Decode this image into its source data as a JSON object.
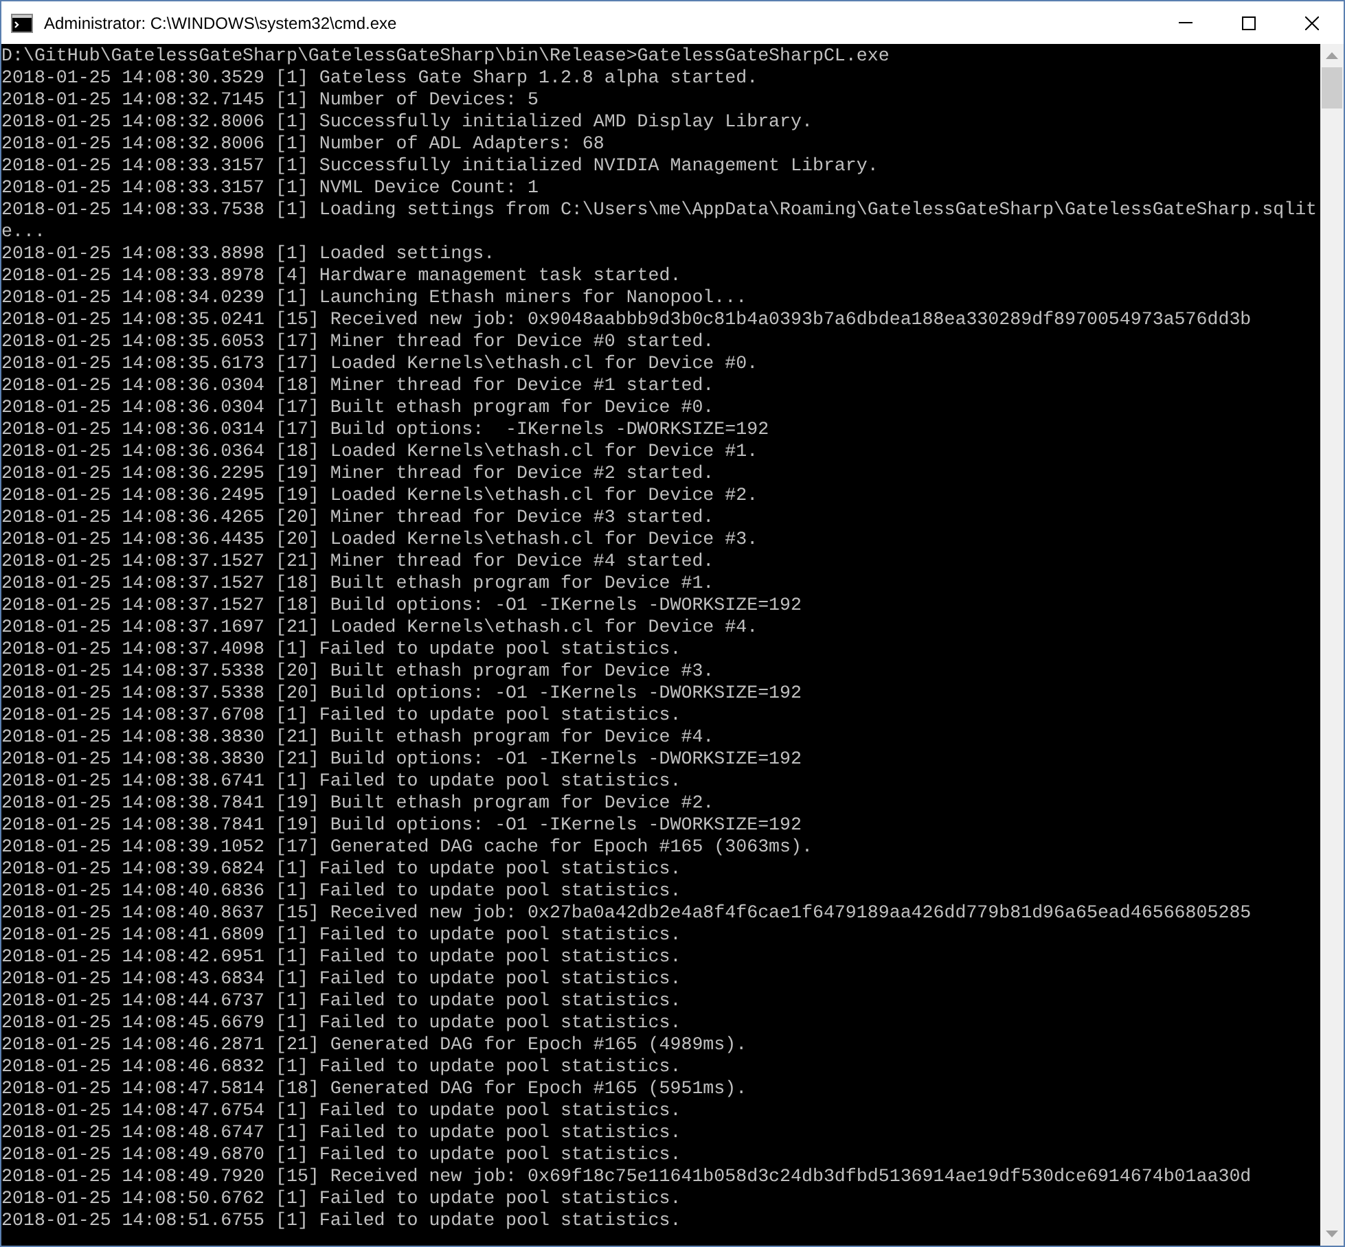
{
  "window": {
    "title": "Administrator: C:\\WINDOWS\\system32\\cmd.exe"
  },
  "console": {
    "lines": [
      "D:\\GitHub\\GatelessGateSharp\\GatelessGateSharp\\bin\\Release>GatelessGateSharpCL.exe",
      "2018-01-25 14:08:30.3529 [1] Gateless Gate Sharp 1.2.8 alpha started.",
      "2018-01-25 14:08:32.7145 [1] Number of Devices: 5",
      "2018-01-25 14:08:32.8006 [1] Successfully initialized AMD Display Library.",
      "2018-01-25 14:08:32.8006 [1] Number of ADL Adapters: 68",
      "2018-01-25 14:08:33.3157 [1] Successfully initialized NVIDIA Management Library.",
      "2018-01-25 14:08:33.3157 [1] NVML Device Count: 1",
      "2018-01-25 14:08:33.7538 [1] Loading settings from C:\\Users\\me\\AppData\\Roaming\\GatelessGateSharp\\GatelessGateSharp.sqlit",
      "e...",
      "2018-01-25 14:08:33.8898 [1] Loaded settings.",
      "2018-01-25 14:08:33.8978 [4] Hardware management task started.",
      "2018-01-25 14:08:34.0239 [1] Launching Ethash miners for Nanopool...",
      "2018-01-25 14:08:35.0241 [15] Received new job: 0x9048aabbb9d3b0c81b4a0393b7a6dbdea188ea330289df8970054973a576dd3b",
      "2018-01-25 14:08:35.6053 [17] Miner thread for Device #0 started.",
      "2018-01-25 14:08:35.6173 [17] Loaded Kernels\\ethash.cl for Device #0.",
      "2018-01-25 14:08:36.0304 [18] Miner thread for Device #1 started.",
      "2018-01-25 14:08:36.0304 [17] Built ethash program for Device #0.",
      "2018-01-25 14:08:36.0314 [17] Build options:  -IKernels -DWORKSIZE=192",
      "2018-01-25 14:08:36.0364 [18] Loaded Kernels\\ethash.cl for Device #1.",
      "2018-01-25 14:08:36.2295 [19] Miner thread for Device #2 started.",
      "2018-01-25 14:08:36.2495 [19] Loaded Kernels\\ethash.cl for Device #2.",
      "2018-01-25 14:08:36.4265 [20] Miner thread for Device #3 started.",
      "2018-01-25 14:08:36.4435 [20] Loaded Kernels\\ethash.cl for Device #3.",
      "2018-01-25 14:08:37.1527 [21] Miner thread for Device #4 started.",
      "2018-01-25 14:08:37.1527 [18] Built ethash program for Device #1.",
      "2018-01-25 14:08:37.1527 [18] Build options: -O1 -IKernels -DWORKSIZE=192",
      "2018-01-25 14:08:37.1697 [21] Loaded Kernels\\ethash.cl for Device #4.",
      "2018-01-25 14:08:37.4098 [1] Failed to update pool statistics.",
      "2018-01-25 14:08:37.5338 [20] Built ethash program for Device #3.",
      "2018-01-25 14:08:37.5338 [20] Build options: -O1 -IKernels -DWORKSIZE=192",
      "2018-01-25 14:08:37.6708 [1] Failed to update pool statistics.",
      "2018-01-25 14:08:38.3830 [21] Built ethash program for Device #4.",
      "2018-01-25 14:08:38.3830 [21] Build options: -O1 -IKernels -DWORKSIZE=192",
      "2018-01-25 14:08:38.6741 [1] Failed to update pool statistics.",
      "2018-01-25 14:08:38.7841 [19] Built ethash program for Device #2.",
      "2018-01-25 14:08:38.7841 [19] Build options: -O1 -IKernels -DWORKSIZE=192",
      "2018-01-25 14:08:39.1052 [17] Generated DAG cache for Epoch #165 (3063ms).",
      "2018-01-25 14:08:39.6824 [1] Failed to update pool statistics.",
      "2018-01-25 14:08:40.6836 [1] Failed to update pool statistics.",
      "2018-01-25 14:08:40.8637 [15] Received new job: 0x27ba0a42db2e4a8f4f6cae1f6479189aa426dd779b81d96a65ead46566805285",
      "2018-01-25 14:08:41.6809 [1] Failed to update pool statistics.",
      "2018-01-25 14:08:42.6951 [1] Failed to update pool statistics.",
      "2018-01-25 14:08:43.6834 [1] Failed to update pool statistics.",
      "2018-01-25 14:08:44.6737 [1] Failed to update pool statistics.",
      "2018-01-25 14:08:45.6679 [1] Failed to update pool statistics.",
      "2018-01-25 14:08:46.2871 [21] Generated DAG for Epoch #165 (4989ms).",
      "2018-01-25 14:08:46.6832 [1] Failed to update pool statistics.",
      "2018-01-25 14:08:47.5814 [18] Generated DAG for Epoch #165 (5951ms).",
      "2018-01-25 14:08:47.6754 [1] Failed to update pool statistics.",
      "2018-01-25 14:08:48.6747 [1] Failed to update pool statistics.",
      "2018-01-25 14:08:49.6870 [1] Failed to update pool statistics.",
      "2018-01-25 14:08:49.7920 [15] Received new job: 0x69f18c75e11641b058d3c24db3dfbd5136914ae19df530dce6914674b01aa30d",
      "2018-01-25 14:08:50.6762 [1] Failed to update pool statistics.",
      "2018-01-25 14:08:51.6755 [1] Failed to update pool statistics."
    ]
  }
}
